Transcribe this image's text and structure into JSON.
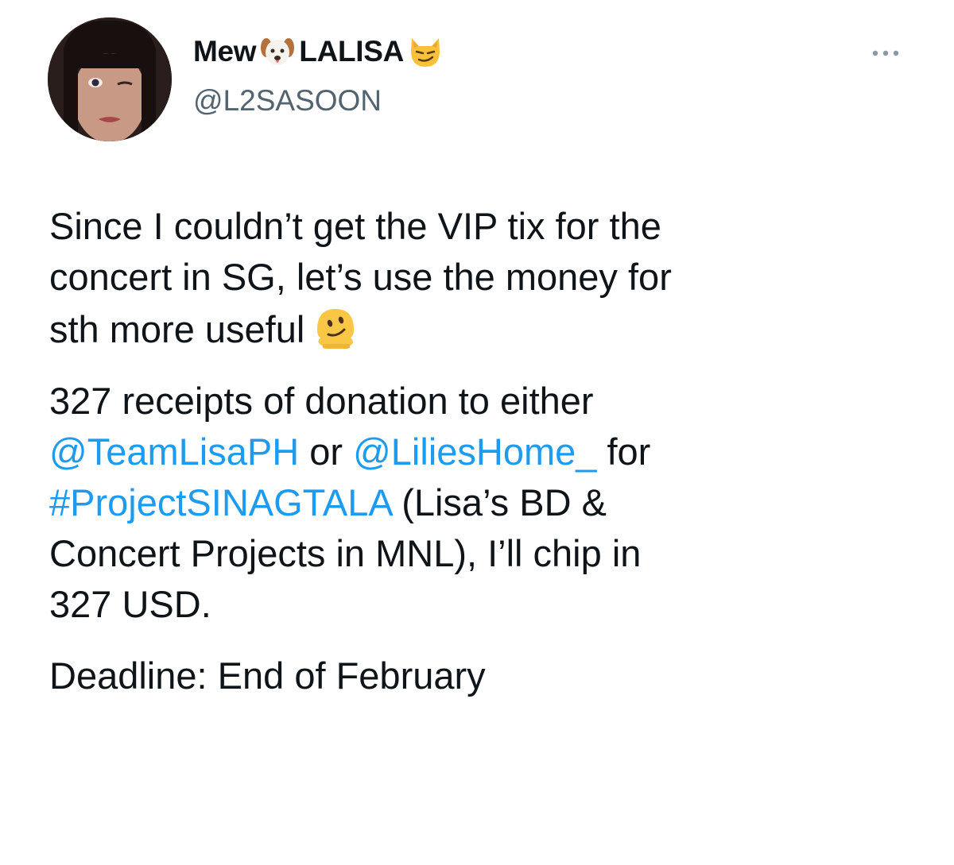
{
  "tweet": {
    "author": {
      "name_prefix": "Mew",
      "name_suffix": "LALISA",
      "name_emoji_1": "dog-face-emoji",
      "name_emoji_2": "smirking-cat-emoji",
      "handle": "@L2SASOON"
    },
    "more_icon": "ellipsis-icon",
    "body": {
      "p1_line1": "Since I couldn’t get the VIP tix for the",
      "p1_line2": "concert in SG, let’s use the money for",
      "p1_line3": "sth more useful",
      "p1_emoji": "melting-face-emoji",
      "p2_line1": "327 receipts of donation to either",
      "p2_mention1": "@TeamLisaPH",
      "p2_or": " or ",
      "p2_mention2": "@LiliesHome_",
      "p2_for": " for",
      "p2_hashtag": "#ProjectSINAGTALA",
      "p2_after_hashtag": " (Lisa’s BD &",
      "p2_line4": "Concert Projects in MNL), I’ll chip in",
      "p2_line5": "327 USD.",
      "p3_line1": "Deadline: End of February"
    },
    "colors": {
      "link": "#1d9bf0",
      "text": "#0f1419",
      "secondary": "#536471"
    }
  }
}
